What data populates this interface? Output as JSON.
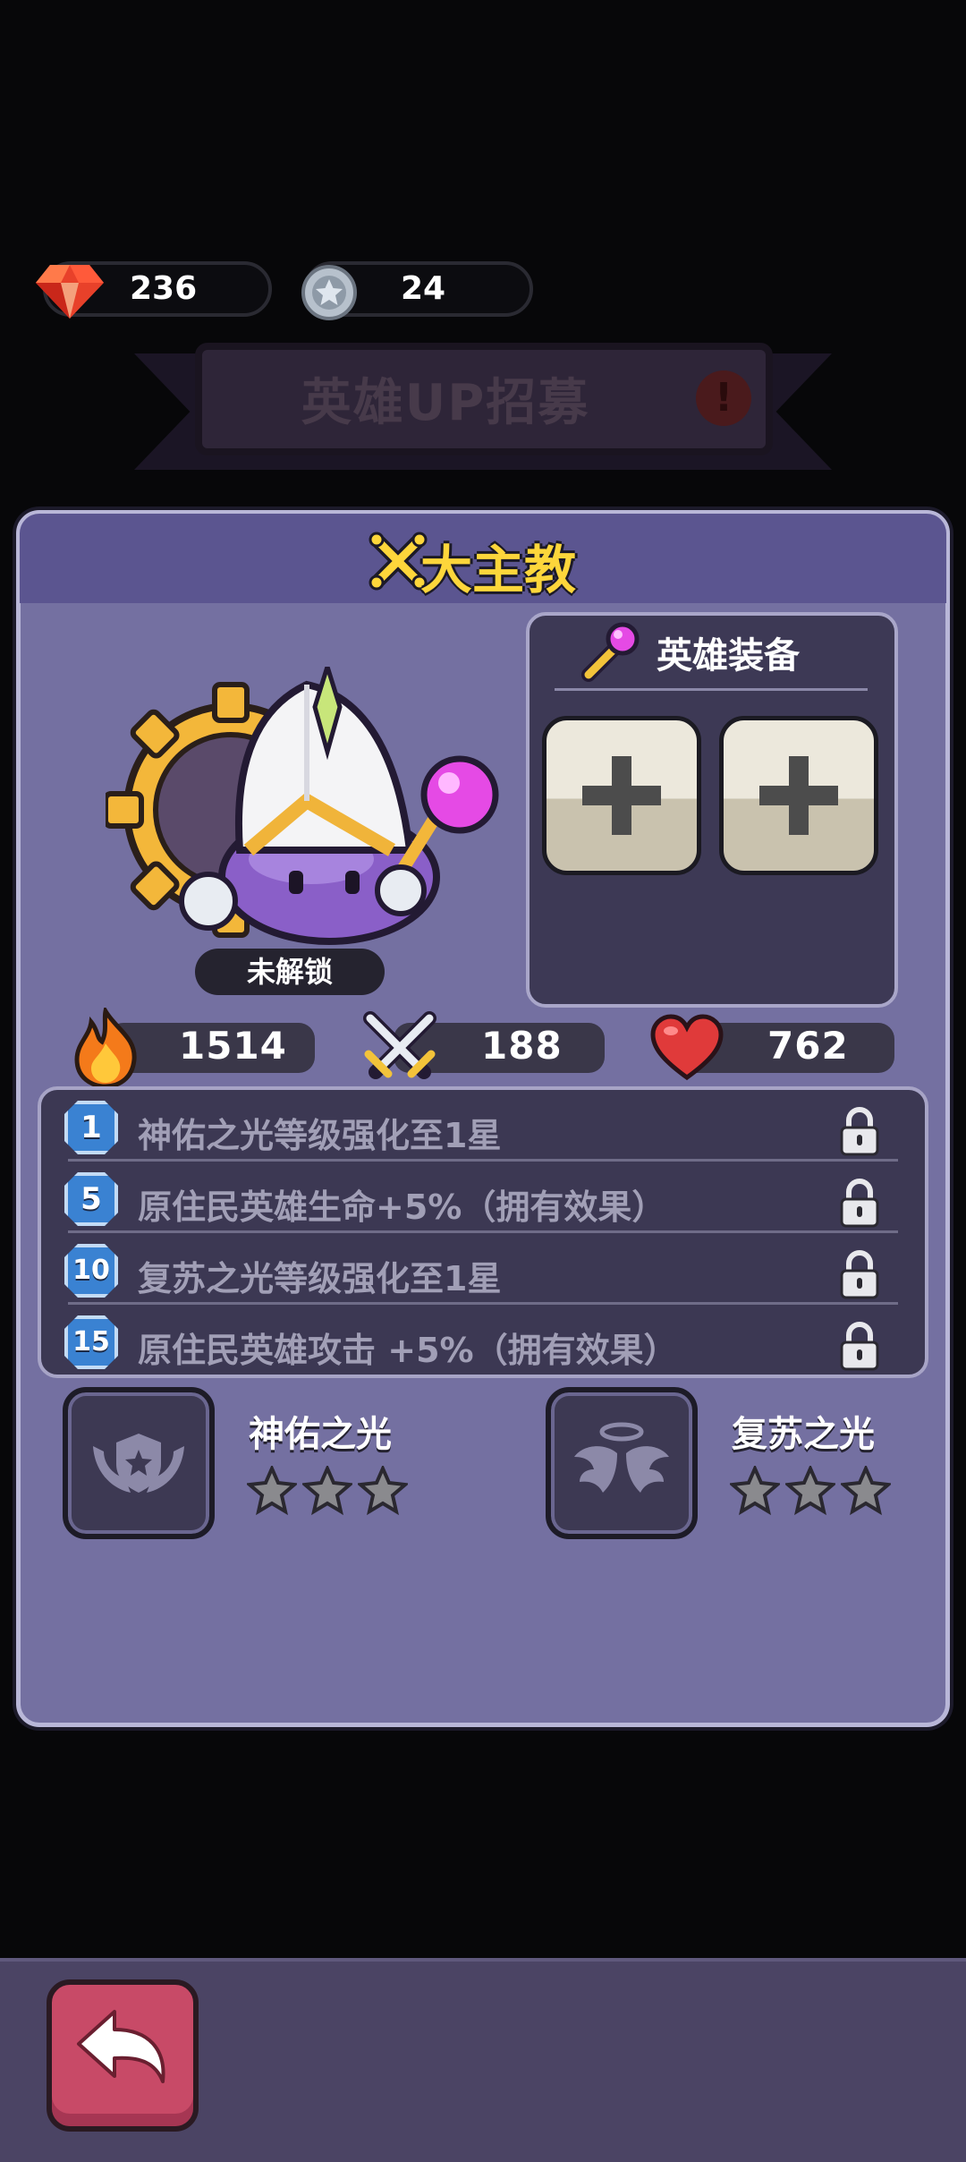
{
  "currency": {
    "gems": "236",
    "tokens": "24",
    "gem_icon": "red-gem-icon",
    "token_icon": "silver-star-coin-icon"
  },
  "banner": {
    "title": "英雄UP招募",
    "alert": "!"
  },
  "hero": {
    "name": "大主教",
    "status": "未解锁",
    "portrait_icon": "archbishop-slime-icon"
  },
  "equipment": {
    "title": "英雄装备",
    "slots": [
      "empty",
      "empty"
    ]
  },
  "stats": {
    "power": "1514",
    "attack": "188",
    "hp": "762"
  },
  "perks": [
    {
      "level": "1",
      "text": "神佑之光等级强化至1星"
    },
    {
      "level": "5",
      "text": "原住民英雄生命+5%（拥有效果）"
    },
    {
      "level": "10",
      "text": "复苏之光等级强化至1星"
    },
    {
      "level": "15",
      "text": "原住民英雄攻击 +5%（拥有效果）"
    }
  ],
  "skills": [
    {
      "name": "神佑之光",
      "stars": 0,
      "max_stars": 3
    },
    {
      "name": "复苏之光",
      "stars": 0,
      "max_stars": 3
    }
  ],
  "colors": {
    "panel": "#7470a1",
    "title_gold": "#fdd63b",
    "back_button": "#c84a67"
  }
}
